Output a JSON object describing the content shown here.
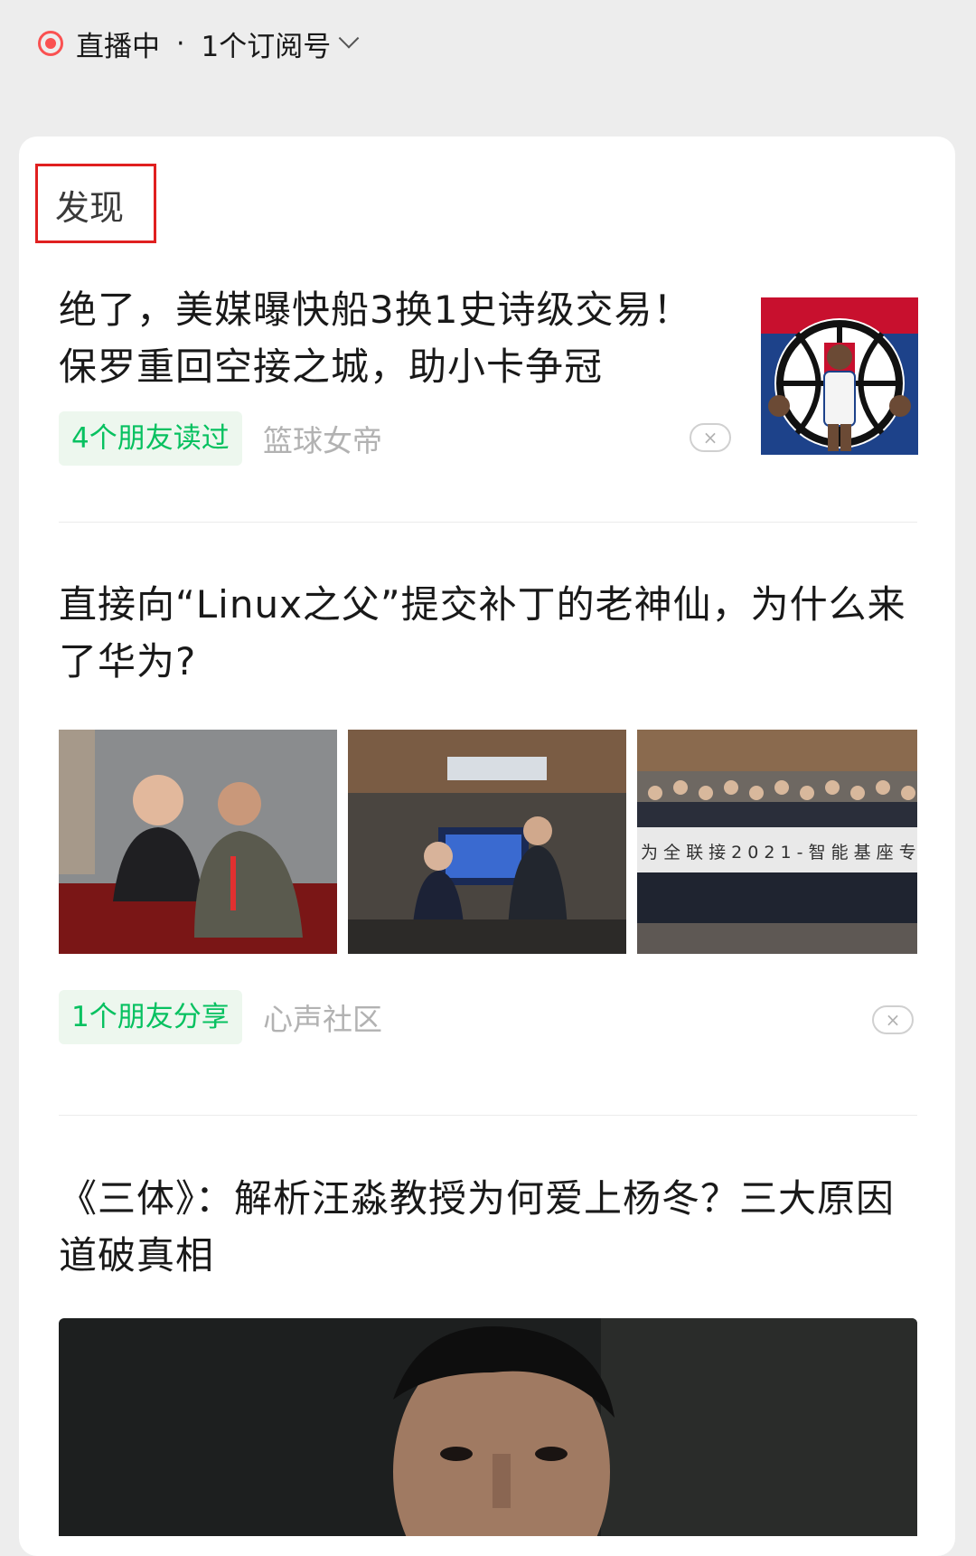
{
  "live_bar": {
    "status": "直播中",
    "separator": "·",
    "subscription": "1个订阅号"
  },
  "section": {
    "title": "发现"
  },
  "articles": [
    {
      "title": "绝了，美媒曝快船3换1史诗级交易！保罗重回空接之城，助小卡争冠",
      "social": "4个朋友读过",
      "source": "篮球女帝",
      "close": "×"
    },
    {
      "title": "直接向“Linux之父”提交补丁的老神仙，为什么来了华为?",
      "social": "1个朋友分享",
      "source": "心声社区",
      "close": "×",
      "banner_text": "为 全 联 接 2 0 2 1 - 智 能 基 座 专"
    },
    {
      "title": "《三体》：解析汪淼教授为何爱上杨冬？三大原因道破真相"
    }
  ],
  "colors": {
    "accent_green": "#07c160",
    "live_red": "#fa5151",
    "highlight_red": "#e02020"
  }
}
